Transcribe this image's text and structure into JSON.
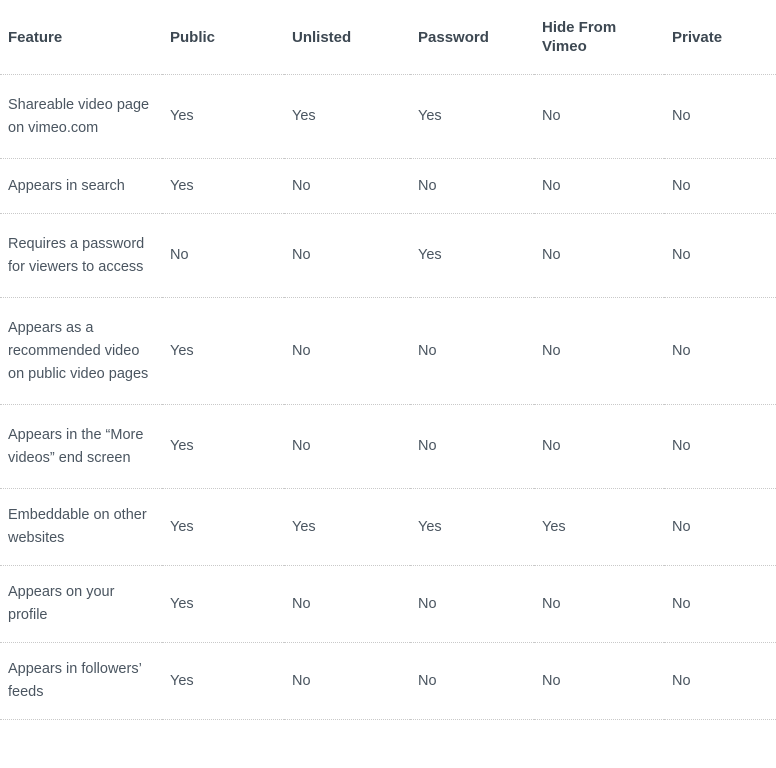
{
  "table": {
    "headers": [
      "Feature",
      "Public",
      "Unlisted",
      "Password",
      "Hide From Vimeo",
      "Private"
    ],
    "rows": [
      {
        "feature": "Shareable video page on vimeo.com",
        "values": [
          "Yes",
          "Yes",
          "Yes",
          "No",
          "No"
        ],
        "lines": 3
      },
      {
        "feature": "Appears in search",
        "values": [
          "Yes",
          "No",
          "No",
          "No",
          "No"
        ],
        "lines": 1
      },
      {
        "feature": "Requires a password for viewers to access",
        "values": [
          "No",
          "No",
          "Yes",
          "No",
          "No"
        ],
        "lines": 3
      },
      {
        "feature": "Appears as a recommended video on public video pages",
        "values": [
          "Yes",
          "No",
          "No",
          "No",
          "No"
        ],
        "lines": 4
      },
      {
        "feature": "Appears in the “More videos” end screen",
        "values": [
          "Yes",
          "No",
          "No",
          "No",
          "No"
        ],
        "lines": 3
      },
      {
        "feature": "Embeddable on other websites",
        "values": [
          "Yes",
          "Yes",
          "Yes",
          "Yes",
          "No"
        ],
        "lines": 2
      },
      {
        "feature": "Appears on your profile",
        "values": [
          "Yes",
          "No",
          "No",
          "No",
          "No"
        ],
        "lines": 2
      },
      {
        "feature": "Appears in followers’ feeds",
        "values": [
          "Yes",
          "No",
          "No",
          "No",
          "No"
        ],
        "lines": 2
      }
    ]
  },
  "colors": {
    "header_text": "#3d4852",
    "body_text": "#4a5560",
    "rule": "#c9c9c9",
    "background": "#ffffff"
  }
}
